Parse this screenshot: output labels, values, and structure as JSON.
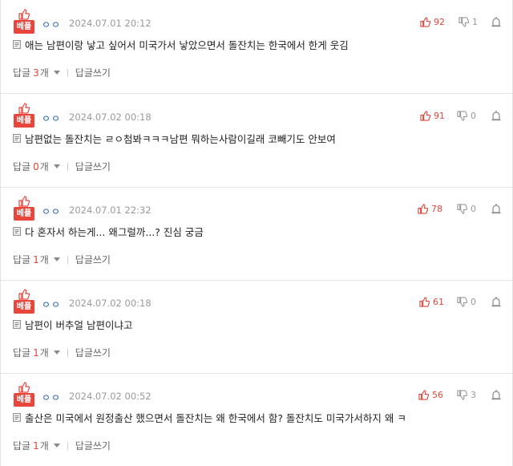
{
  "labels": {
    "badge": "베플",
    "reply_prefix": "답글",
    "reply_suffix": "개",
    "write_reply": "답글쓰기"
  },
  "comments": [
    {
      "nickname": "ㅇㅇ",
      "date": "2024.07.01 20:12",
      "likes": "92",
      "dislikes": "1",
      "text": "애는 남편이랑 낳고 싶어서 미국가서 낳았으면서 돌잔치는 한국에서 한게 웃김",
      "reply_count": "3"
    },
    {
      "nickname": "ㅇㅇ",
      "date": "2024.07.02 00:18",
      "likes": "91",
      "dislikes": "0",
      "text": "남편없는 돌잔치는 ㄹㅇ첨봐ㅋㅋㅋ남편 뭐하는사람이길래 코빼기도 안보여",
      "reply_count": "0"
    },
    {
      "nickname": "ㅇㅇ",
      "date": "2024.07.01 22:32",
      "likes": "78",
      "dislikes": "0",
      "text": "다 혼자서 하는게... 왜그럴까...? 진심 궁금",
      "reply_count": "1"
    },
    {
      "nickname": "ㅇㅇ",
      "date": "2024.07.02 00:18",
      "likes": "61",
      "dislikes": "0",
      "text": "남편이 버추얼 남편이냐고",
      "reply_count": "1"
    },
    {
      "nickname": "ㅇㅇ",
      "date": "2024.07.02 00:52",
      "likes": "56",
      "dislikes": "3",
      "text": "출산은 미국에서 원정출산 했으면서 돌잔치는 왜 한국에서 함? 돌잔치도 미국가서하지 왜 ㅋ",
      "reply_count": "1"
    }
  ],
  "colors": {
    "accent": "#e0453a",
    "badge": "#e8453c",
    "nickname": "#1f5fae",
    "muted": "#9a9a9a"
  },
  "icons": {
    "badge": "thumbs-up-icon",
    "like": "thumbs-up-icon",
    "dislike": "thumbs-down-icon",
    "report": "siren-icon",
    "body": "document-icon",
    "reply_toggle": "caret-down-icon"
  }
}
